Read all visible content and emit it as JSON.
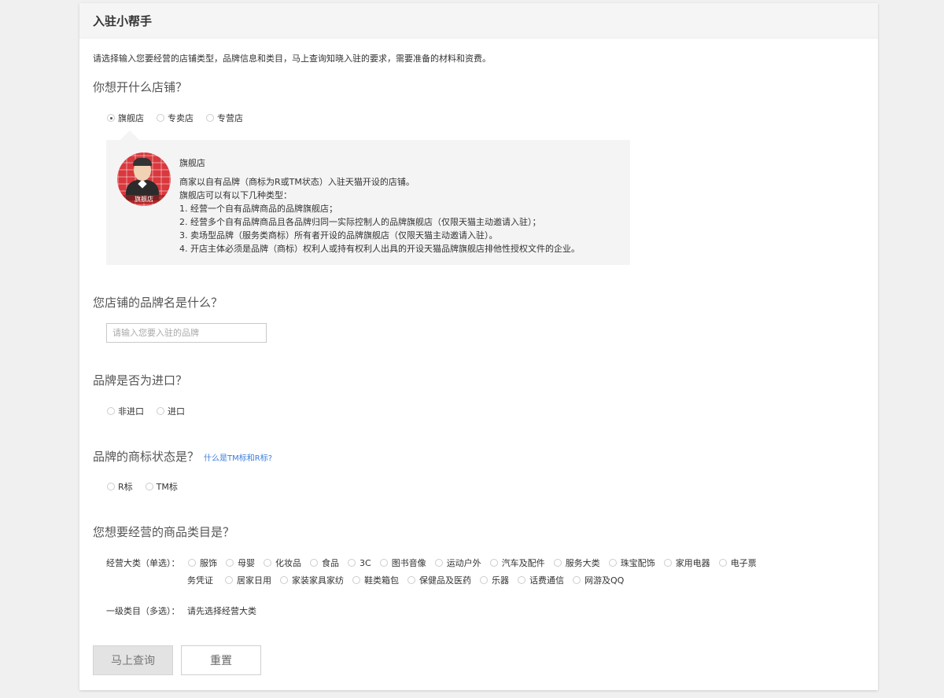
{
  "header": {
    "title": "入驻小帮手"
  },
  "intro": "请选择输入您要经营的店铺类型，品牌信息和类目，马上查询知晓入驻的要求，需要准备的材料和资费。",
  "store_type": {
    "question": "你想开什么店铺？",
    "options": [
      {
        "label": "旗舰店",
        "checked": true
      },
      {
        "label": "专卖店",
        "checked": false
      },
      {
        "label": "专营店",
        "checked": false
      }
    ]
  },
  "store_info": {
    "badge_label": "旗舰店",
    "title": "旗舰店",
    "lines": [
      "商家以自有品牌（商标为R或TM状态）入驻天猫开设的店铺。",
      "旗舰店可以有以下几种类型：",
      "1. 经营一个自有品牌商品的品牌旗舰店；",
      "2. 经营多个自有品牌商品且各品牌归同一实际控制人的品牌旗舰店（仅限天猫主动邀请入驻）；",
      "3. 卖场型品牌（服务类商标）所有者开设的品牌旗舰店（仅限天猫主动邀请入驻）。",
      "4. 开店主体必须是品牌（商标）权利人或持有权利人出具的开设天猫品牌旗舰店排他性授权文件的企业。"
    ]
  },
  "brand_name": {
    "question": "您店铺的品牌名是什么？",
    "placeholder": "请输入您要入驻的品牌",
    "value": ""
  },
  "import": {
    "question": "品牌是否为进口？",
    "options": [
      {
        "label": "非进口",
        "checked": false
      },
      {
        "label": "进口",
        "checked": false
      }
    ]
  },
  "trademark": {
    "question": "品牌的商标状态是？",
    "help_link": "什么是TM标和R标?",
    "options": [
      {
        "label": "R标",
        "checked": false
      },
      {
        "label": "TM标",
        "checked": false
      }
    ]
  },
  "category": {
    "question": "您想要经营的商品类目是？",
    "main_label": "经营大类（单选）：",
    "main_row1": [
      "服饰",
      "母婴",
      "化妆品",
      "食品",
      "3C",
      "图书音像",
      "运动户外",
      "汽车及配件",
      "服务大类",
      "珠宝配饰",
      "家用电器",
      "电子票"
    ],
    "main_row2_prefix": "务凭证",
    "main_row2": [
      "居家日用",
      "家装家具家纺",
      "鞋类箱包",
      "保健品及医药",
      "乐器",
      "话费通信",
      "网游及QQ"
    ],
    "sub_label": "一级类目（多选）：",
    "sub_hint": "请先选择经营大类"
  },
  "buttons": {
    "query": "马上查询",
    "reset": "重置"
  }
}
